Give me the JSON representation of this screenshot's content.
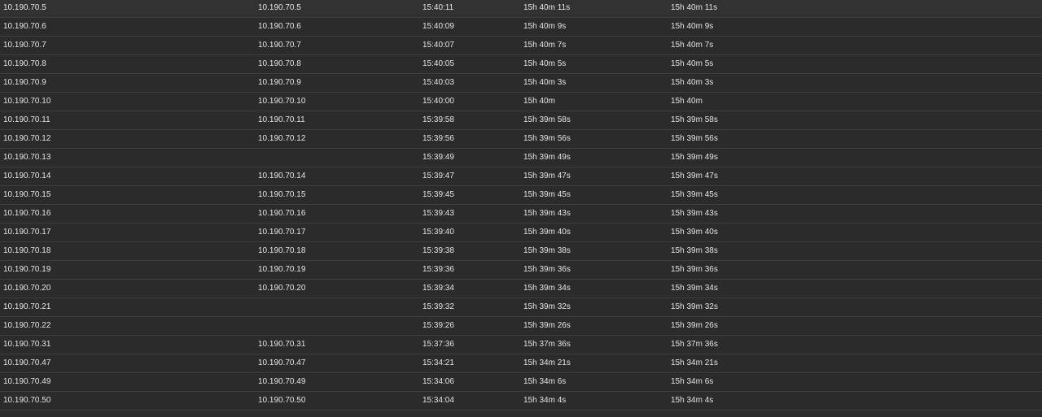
{
  "table": {
    "rows": [
      [
        "10.190.70.5",
        "10.190.70.5",
        "15:40:11",
        "15h 40m 11s",
        "15h 40m 11s"
      ],
      [
        "10.190.70.6",
        "10.190.70.6",
        "15:40:09",
        "15h 40m 9s",
        "15h 40m 9s"
      ],
      [
        "10.190.70.7",
        "10.190.70.7",
        "15:40:07",
        "15h 40m 7s",
        "15h 40m 7s"
      ],
      [
        "10.190.70.8",
        "10.190.70.8",
        "15:40:05",
        "15h 40m 5s",
        "15h 40m 5s"
      ],
      [
        "10.190.70.9",
        "10.190.70.9",
        "15:40:03",
        "15h 40m 3s",
        "15h 40m 3s"
      ],
      [
        "10.190.70.10",
        "10.190.70.10",
        "15:40:00",
        "15h 40m",
        "15h 40m"
      ],
      [
        "10.190.70.11",
        "10.190.70.11",
        "15:39:58",
        "15h 39m 58s",
        "15h 39m 58s"
      ],
      [
        "10.190.70.12",
        "10.190.70.12",
        "15:39:56",
        "15h 39m 56s",
        "15h 39m 56s"
      ],
      [
        "10.190.70.13",
        "",
        "15:39:49",
        "15h 39m 49s",
        "15h 39m 49s"
      ],
      [
        "10.190.70.14",
        "10.190.70.14",
        "15:39:47",
        "15h 39m 47s",
        "15h 39m 47s"
      ],
      [
        "10.190.70.15",
        "10.190.70.15",
        "15:39:45",
        "15h 39m 45s",
        "15h 39m 45s"
      ],
      [
        "10.190.70.16",
        "10.190.70.16",
        "15:39:43",
        "15h 39m 43s",
        "15h 39m 43s"
      ],
      [
        "10.190.70.17",
        "10.190.70.17",
        "15:39:40",
        "15h 39m 40s",
        "15h 39m 40s"
      ],
      [
        "10.190.70.18",
        "10.190.70.18",
        "15:39:38",
        "15h 39m 38s",
        "15h 39m 38s"
      ],
      [
        "10.190.70.19",
        "10.190.70.19",
        "15:39:36",
        "15h 39m 36s",
        "15h 39m 36s"
      ],
      [
        "10.190.70.20",
        "10.190.70.20",
        "15:39:34",
        "15h 39m 34s",
        "15h 39m 34s"
      ],
      [
        "10.190.70.21",
        "",
        "15:39:32",
        "15h 39m 32s",
        "15h 39m 32s"
      ],
      [
        "10.190.70.22",
        "",
        "15:39:26",
        "15h 39m 26s",
        "15h 39m 26s"
      ],
      [
        "10.190.70.31",
        "10.190.70.31",
        "15:37:36",
        "15h 37m 36s",
        "15h 37m 36s"
      ],
      [
        "10.190.70.47",
        "10.190.70.47",
        "15:34:21",
        "15h 34m 21s",
        "15h 34m 21s"
      ],
      [
        "10.190.70.49",
        "10.190.70.49",
        "15:34:06",
        "15h 34m 6s",
        "15h 34m 6s"
      ],
      [
        "10.190.70.50",
        "10.190.70.50",
        "15:34:04",
        "15h 34m 4s",
        "15h 34m 4s"
      ]
    ]
  }
}
